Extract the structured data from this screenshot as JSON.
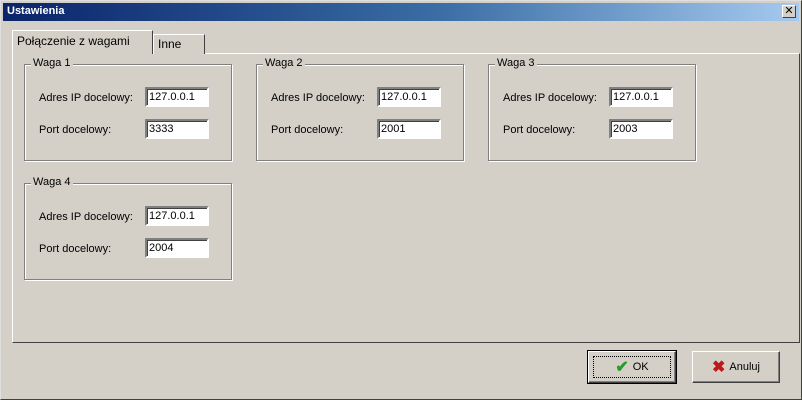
{
  "window": {
    "title": "Ustawienia",
    "close_glyph": "✕"
  },
  "tabs": [
    {
      "label": "Połączenie z wagami",
      "active": true
    },
    {
      "label": "Inne",
      "active": false
    }
  ],
  "groups": [
    {
      "title": "Waga 1",
      "ip_label": "Adres IP docelowy:",
      "ip_value": "127.0.0.1",
      "port_label": "Port docelowy:",
      "port_value": "3333"
    },
    {
      "title": "Waga 2",
      "ip_label": "Adres IP docelowy:",
      "ip_value": "127.0.0.1",
      "port_label": "Port docelowy:",
      "port_value": "2001"
    },
    {
      "title": "Waga 3",
      "ip_label": "Adres IP docelowy:",
      "ip_value": "127.0.0.1",
      "port_label": "Port docelowy:",
      "port_value": "2003"
    },
    {
      "title": "Waga 4",
      "ip_label": "Adres IP docelowy:",
      "ip_value": "127.0.0.1",
      "port_label": "Port docelowy:",
      "port_value": "2004"
    }
  ],
  "buttons": {
    "ok_label": "OK",
    "ok_icon": "check-icon",
    "ok_glyph": "✔",
    "cancel_label": "Anuluj",
    "cancel_icon": "x-icon",
    "cancel_glyph": "✖"
  }
}
